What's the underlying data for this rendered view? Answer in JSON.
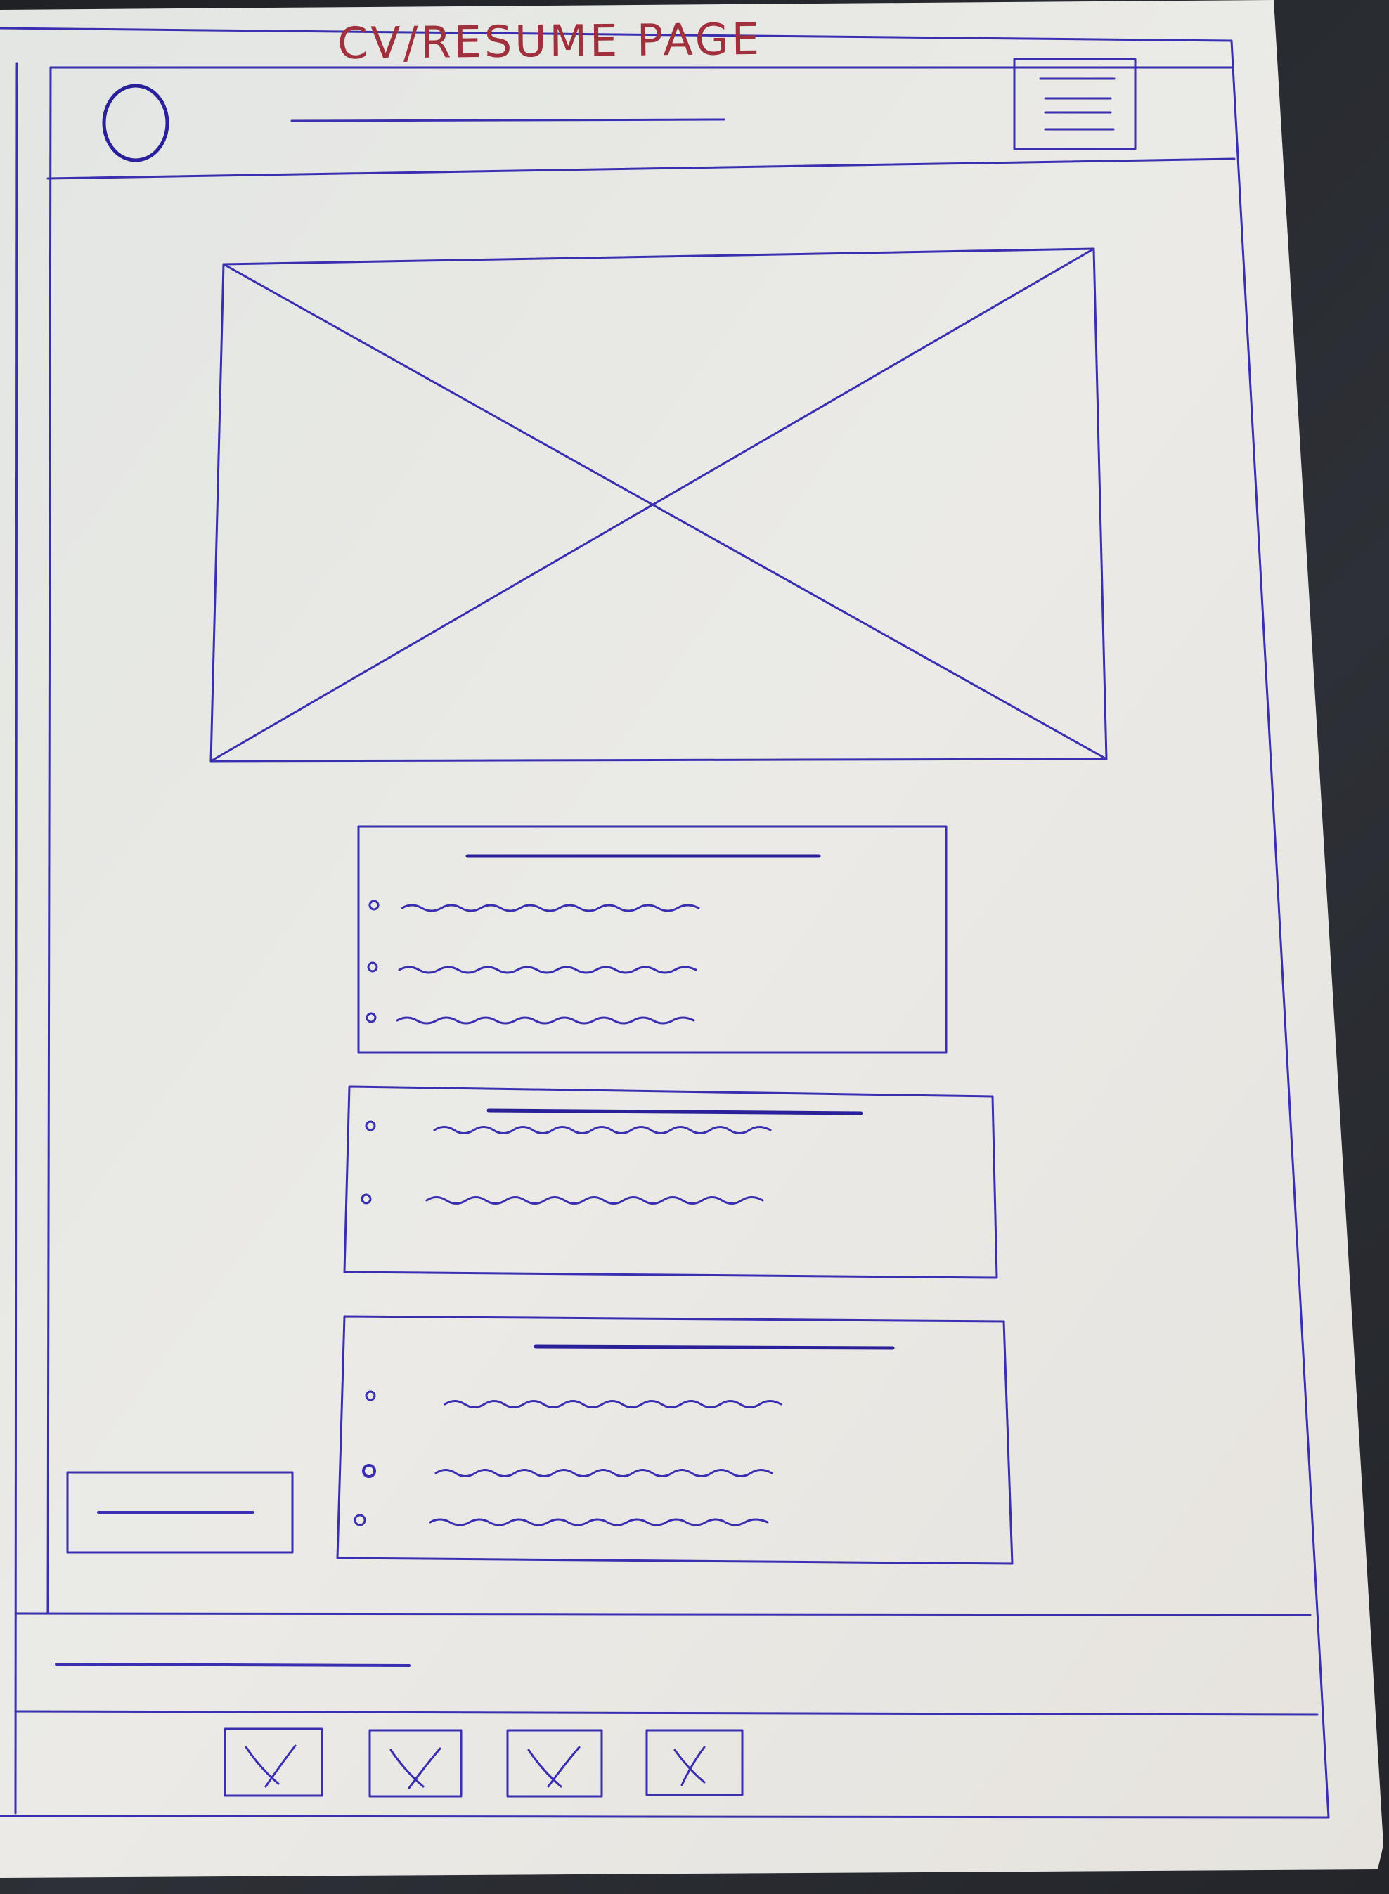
{
  "sheet": {
    "title": "CV/RESUME PAGE",
    "ink_color": "#3a2fb0",
    "title_color": "#a0303c",
    "paper_color": "#e9e8e3"
  },
  "header": {
    "logo_icon": "circle-logo-icon",
    "menu_icon": "hamburger-menu-icon"
  },
  "hero": {
    "image_icon": "image-placeholder-icon"
  },
  "sections": [
    {
      "bullets": 3
    },
    {
      "bullets": 2
    },
    {
      "bullets": 3
    }
  ],
  "footer": {
    "social_icons": [
      "social-icon-1",
      "social-icon-2",
      "social-icon-3",
      "social-icon-4"
    ]
  }
}
